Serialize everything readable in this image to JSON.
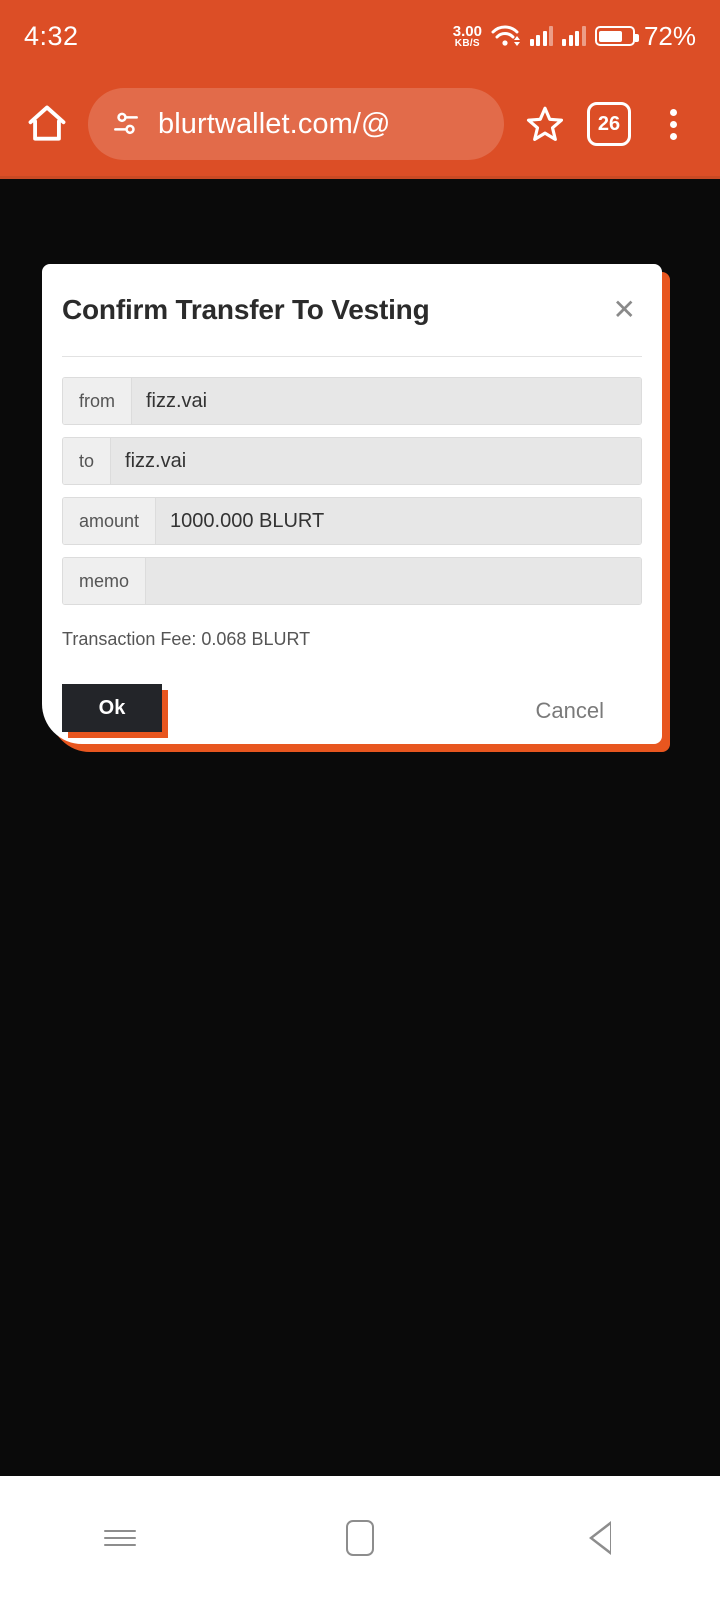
{
  "status_bar": {
    "time": "4:32",
    "network_speed_value": "3.00",
    "network_speed_unit": "KB/S",
    "battery_percent": "72%",
    "icons": [
      "wifi-icon",
      "signal-icon",
      "signal-icon",
      "battery-icon"
    ],
    "background_color": "#DC4E26"
  },
  "browser_toolbar": {
    "home_icon": "home-icon",
    "site_settings_icon": "tune-icon",
    "url": "blurtwallet.com/@",
    "bookmark_icon": "star-icon",
    "tab_count": "26",
    "menu_icon": "overflow-menu-icon",
    "background_color": "#DC4E26"
  },
  "dialog": {
    "title": "Confirm Transfer To Vesting",
    "close_icon": "close-icon",
    "fields": [
      {
        "label": "from",
        "value": "fizz.vai"
      },
      {
        "label": "to",
        "value": "fizz.vai"
      },
      {
        "label": "amount",
        "value": "1000.000 BLURT"
      },
      {
        "label": "memo",
        "value": ""
      }
    ],
    "fee_text": "Transaction Fee: 0.068 BLURT",
    "ok_label": "Ok",
    "cancel_label": "Cancel",
    "accent_color": "#E8561F",
    "ok_button_color": "#232529"
  },
  "nav_bar": {
    "recents_icon": "menu-icon",
    "home_icon": "home-square-icon",
    "back_icon": "back-triangle-icon"
  }
}
